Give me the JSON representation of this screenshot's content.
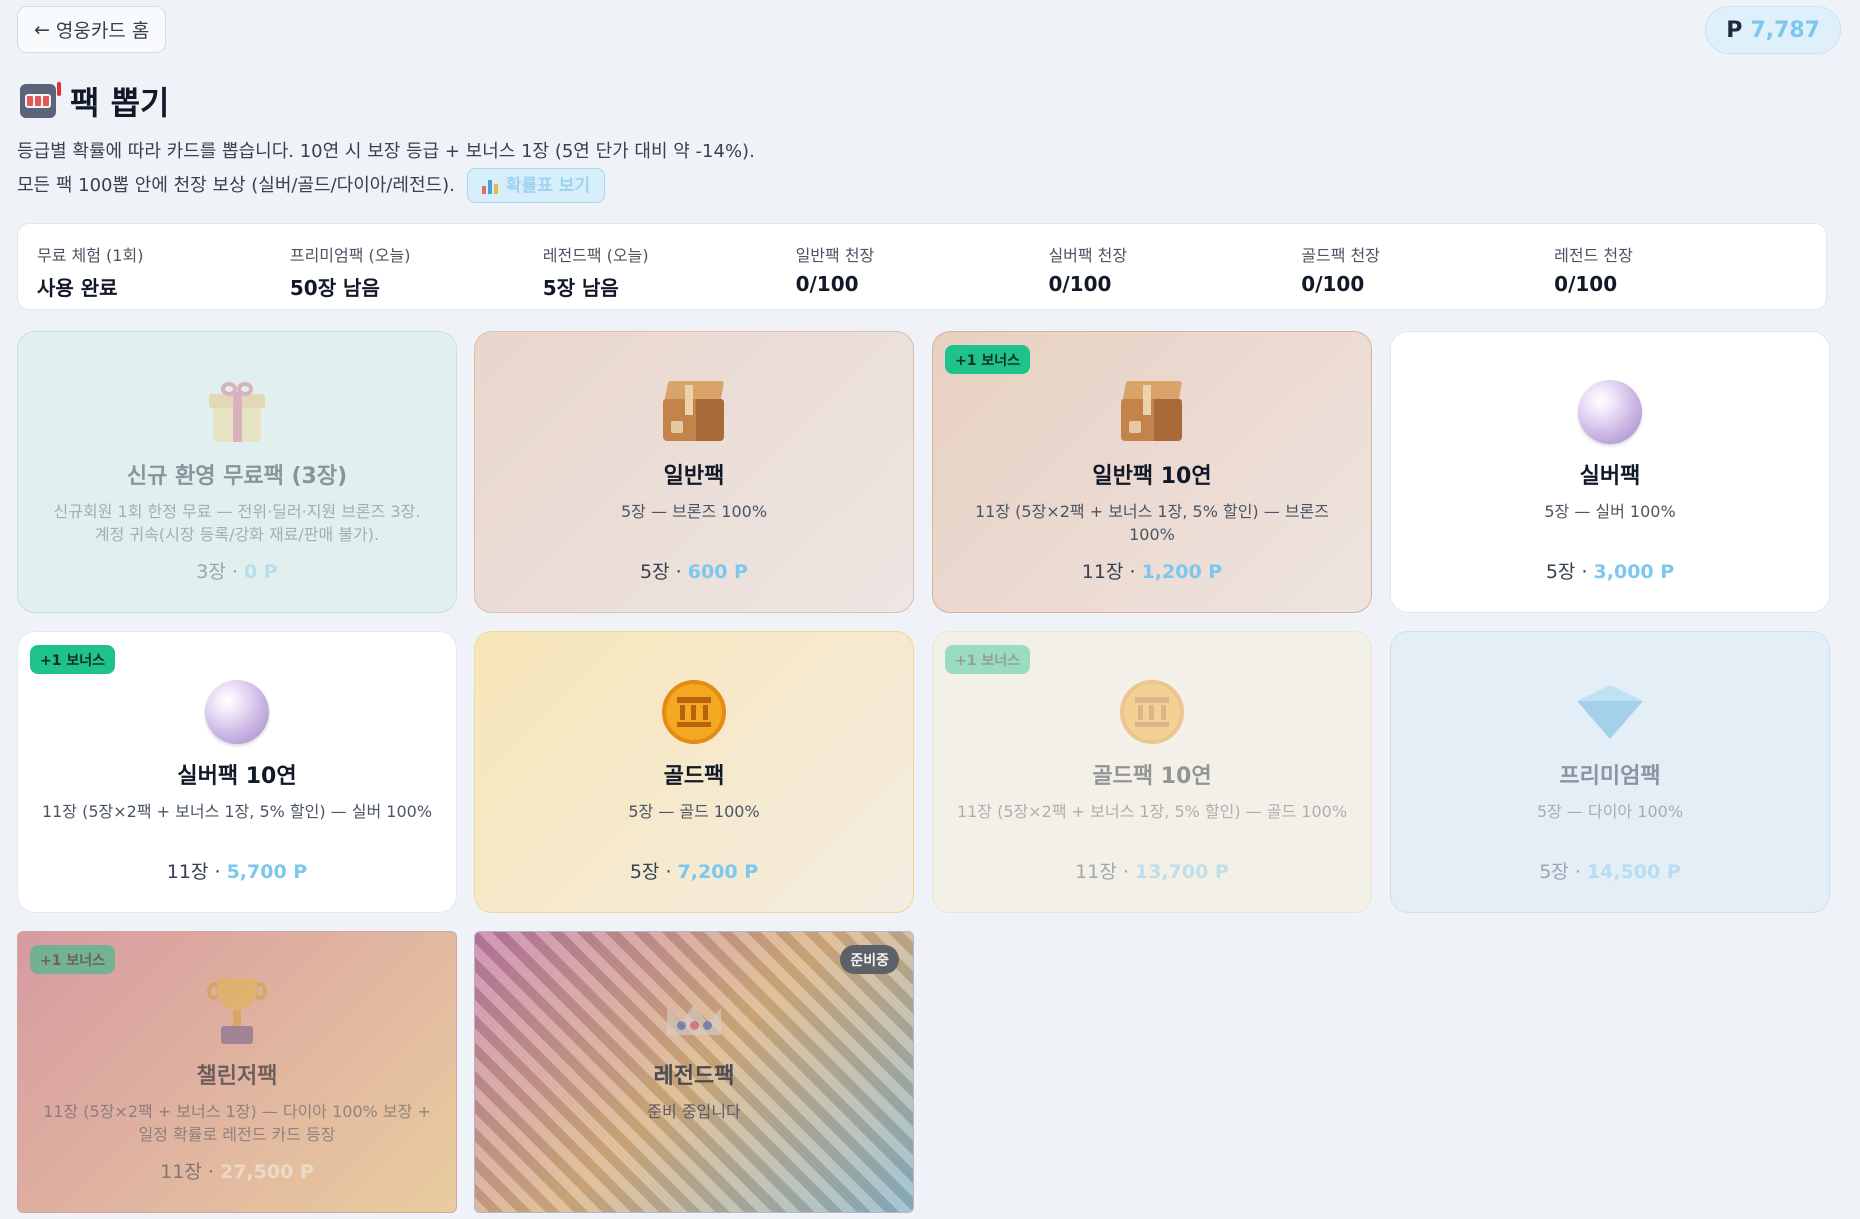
{
  "header": {
    "back_arrow": "←",
    "back_label": "영웅카드 홈",
    "points_prefix": "P",
    "points_value": "7,787"
  },
  "title": "팩 뽑기",
  "description": {
    "line1": "등급별 확률에 따라 카드를 뽑습니다. 10연 시 보장 등급 + 보너스 1장 (5연 단가 대비 약 -14%).",
    "line2": "모든 팩 100뽑 안에 천장 보상 (실버/골드/다이아/레전드).",
    "prob_button": "확률표 보기"
  },
  "stats": [
    {
      "label": "무료 체험 (1회)",
      "value": "사용 완료"
    },
    {
      "label": "프리미엄팩 (오늘)",
      "value": "50장 남음"
    },
    {
      "label": "레전드팩 (오늘)",
      "value": "5장 남음"
    },
    {
      "label": "일반팩 천장",
      "value": "0/100"
    },
    {
      "label": "실버팩 천장",
      "value": "0/100"
    },
    {
      "label": "골드팩 천장",
      "value": "0/100"
    },
    {
      "label": "레전드 천장",
      "value": "0/100"
    }
  ],
  "packs": [
    {
      "name": "신규 환영 무료팩 (3장)",
      "desc": "신규회원 1회 한정 무료 — 전위·딜러·지원 브론즈 3장.",
      "desc2": "계정 귀속(시장 등록/강화 재료/판매 불가).",
      "count": "3장",
      "sep": "·",
      "price": "0 P",
      "icon": "gift-icon"
    },
    {
      "name": "일반팩",
      "desc": "5장 — 브론즈 100%",
      "count": "5장",
      "sep": "·",
      "price": "600 P",
      "icon": "package-icon"
    },
    {
      "name": "일반팩 10연",
      "desc": "11장 (5장×2팩 + 보너스 1장, 5% 할인) — 브론즈 100%",
      "count": "11장",
      "sep": "·",
      "price": "1,200 P",
      "badge": "+1 보너스",
      "icon": "package-icon"
    },
    {
      "name": "실버팩",
      "desc": "5장 — 실버 100%",
      "count": "5장",
      "sep": "·",
      "price": "3,000 P",
      "icon": "pearl-icon"
    },
    {
      "name": "실버팩 10연",
      "desc": "11장 (5장×2팩 + 보너스 1장, 5% 할인) — 실버 100%",
      "count": "11장",
      "sep": "·",
      "price": "5,700 P",
      "badge": "+1 보너스",
      "icon": "pearl-icon"
    },
    {
      "name": "골드팩",
      "desc": "5장 — 골드 100%",
      "count": "5장",
      "sep": "·",
      "price": "7,200 P",
      "icon": "gold-coin-icon"
    },
    {
      "name": "골드팩 10연",
      "desc": "11장 (5장×2팩 + 보너스 1장, 5% 할인) — 골드 100%",
      "count": "11장",
      "sep": "·",
      "price": "13,700 P",
      "badge": "+1 보너스",
      "icon": "gold-coin-icon"
    },
    {
      "name": "프리미엄팩",
      "desc": "5장 — 다이아 100%",
      "count": "5장",
      "sep": "·",
      "price": "14,500 P",
      "icon": "diamond-icon"
    },
    {
      "name": "챌린저팩",
      "desc": "11장 (5장×2팩 + 보너스 1장) — 다이아 100% 보장 +",
      "desc2": "일정 확률로 레전드 카드 등장",
      "count": "11장",
      "sep": "·",
      "price": "27,500 P",
      "badge": "+1 보너스",
      "icon": "trophy-icon"
    },
    {
      "name": "레전드팩",
      "desc": "준비 중입니다",
      "badge_right": "준비중",
      "icon": "crown-icon"
    }
  ],
  "colors": {
    "accent_points": "#7cc7ee",
    "bonus_badge": "#1fc28a",
    "background": "#eff2f7"
  }
}
